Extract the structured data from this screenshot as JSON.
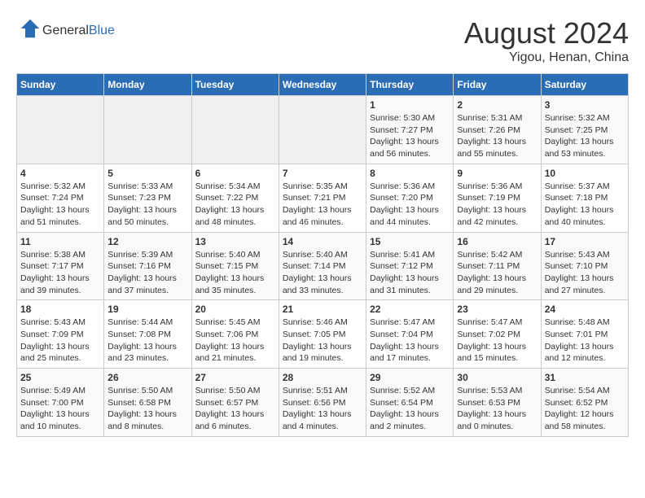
{
  "header": {
    "logo_general": "General",
    "logo_blue": "Blue",
    "main_title": "August 2024",
    "subtitle": "Yigou, Henan, China"
  },
  "calendar": {
    "weekdays": [
      "Sunday",
      "Monday",
      "Tuesday",
      "Wednesday",
      "Thursday",
      "Friday",
      "Saturday"
    ],
    "weeks": [
      [
        {
          "day": "",
          "sunrise": "",
          "sunset": "",
          "daylight": ""
        },
        {
          "day": "",
          "sunrise": "",
          "sunset": "",
          "daylight": ""
        },
        {
          "day": "",
          "sunrise": "",
          "sunset": "",
          "daylight": ""
        },
        {
          "day": "",
          "sunrise": "",
          "sunset": "",
          "daylight": ""
        },
        {
          "day": "1",
          "sunrise": "Sunrise: 5:30 AM",
          "sunset": "Sunset: 7:27 PM",
          "daylight": "Daylight: 13 hours and 56 minutes."
        },
        {
          "day": "2",
          "sunrise": "Sunrise: 5:31 AM",
          "sunset": "Sunset: 7:26 PM",
          "daylight": "Daylight: 13 hours and 55 minutes."
        },
        {
          "day": "3",
          "sunrise": "Sunrise: 5:32 AM",
          "sunset": "Sunset: 7:25 PM",
          "daylight": "Daylight: 13 hours and 53 minutes."
        }
      ],
      [
        {
          "day": "4",
          "sunrise": "Sunrise: 5:32 AM",
          "sunset": "Sunset: 7:24 PM",
          "daylight": "Daylight: 13 hours and 51 minutes."
        },
        {
          "day": "5",
          "sunrise": "Sunrise: 5:33 AM",
          "sunset": "Sunset: 7:23 PM",
          "daylight": "Daylight: 13 hours and 50 minutes."
        },
        {
          "day": "6",
          "sunrise": "Sunrise: 5:34 AM",
          "sunset": "Sunset: 7:22 PM",
          "daylight": "Daylight: 13 hours and 48 minutes."
        },
        {
          "day": "7",
          "sunrise": "Sunrise: 5:35 AM",
          "sunset": "Sunset: 7:21 PM",
          "daylight": "Daylight: 13 hours and 46 minutes."
        },
        {
          "day": "8",
          "sunrise": "Sunrise: 5:36 AM",
          "sunset": "Sunset: 7:20 PM",
          "daylight": "Daylight: 13 hours and 44 minutes."
        },
        {
          "day": "9",
          "sunrise": "Sunrise: 5:36 AM",
          "sunset": "Sunset: 7:19 PM",
          "daylight": "Daylight: 13 hours and 42 minutes."
        },
        {
          "day": "10",
          "sunrise": "Sunrise: 5:37 AM",
          "sunset": "Sunset: 7:18 PM",
          "daylight": "Daylight: 13 hours and 40 minutes."
        }
      ],
      [
        {
          "day": "11",
          "sunrise": "Sunrise: 5:38 AM",
          "sunset": "Sunset: 7:17 PM",
          "daylight": "Daylight: 13 hours and 39 minutes."
        },
        {
          "day": "12",
          "sunrise": "Sunrise: 5:39 AM",
          "sunset": "Sunset: 7:16 PM",
          "daylight": "Daylight: 13 hours and 37 minutes."
        },
        {
          "day": "13",
          "sunrise": "Sunrise: 5:40 AM",
          "sunset": "Sunset: 7:15 PM",
          "daylight": "Daylight: 13 hours and 35 minutes."
        },
        {
          "day": "14",
          "sunrise": "Sunrise: 5:40 AM",
          "sunset": "Sunset: 7:14 PM",
          "daylight": "Daylight: 13 hours and 33 minutes."
        },
        {
          "day": "15",
          "sunrise": "Sunrise: 5:41 AM",
          "sunset": "Sunset: 7:12 PM",
          "daylight": "Daylight: 13 hours and 31 minutes."
        },
        {
          "day": "16",
          "sunrise": "Sunrise: 5:42 AM",
          "sunset": "Sunset: 7:11 PM",
          "daylight": "Daylight: 13 hours and 29 minutes."
        },
        {
          "day": "17",
          "sunrise": "Sunrise: 5:43 AM",
          "sunset": "Sunset: 7:10 PM",
          "daylight": "Daylight: 13 hours and 27 minutes."
        }
      ],
      [
        {
          "day": "18",
          "sunrise": "Sunrise: 5:43 AM",
          "sunset": "Sunset: 7:09 PM",
          "daylight": "Daylight: 13 hours and 25 minutes."
        },
        {
          "day": "19",
          "sunrise": "Sunrise: 5:44 AM",
          "sunset": "Sunset: 7:08 PM",
          "daylight": "Daylight: 13 hours and 23 minutes."
        },
        {
          "day": "20",
          "sunrise": "Sunrise: 5:45 AM",
          "sunset": "Sunset: 7:06 PM",
          "daylight": "Daylight: 13 hours and 21 minutes."
        },
        {
          "day": "21",
          "sunrise": "Sunrise: 5:46 AM",
          "sunset": "Sunset: 7:05 PM",
          "daylight": "Daylight: 13 hours and 19 minutes."
        },
        {
          "day": "22",
          "sunrise": "Sunrise: 5:47 AM",
          "sunset": "Sunset: 7:04 PM",
          "daylight": "Daylight: 13 hours and 17 minutes."
        },
        {
          "day": "23",
          "sunrise": "Sunrise: 5:47 AM",
          "sunset": "Sunset: 7:02 PM",
          "daylight": "Daylight: 13 hours and 15 minutes."
        },
        {
          "day": "24",
          "sunrise": "Sunrise: 5:48 AM",
          "sunset": "Sunset: 7:01 PM",
          "daylight": "Daylight: 13 hours and 12 minutes."
        }
      ],
      [
        {
          "day": "25",
          "sunrise": "Sunrise: 5:49 AM",
          "sunset": "Sunset: 7:00 PM",
          "daylight": "Daylight: 13 hours and 10 minutes."
        },
        {
          "day": "26",
          "sunrise": "Sunrise: 5:50 AM",
          "sunset": "Sunset: 6:58 PM",
          "daylight": "Daylight: 13 hours and 8 minutes."
        },
        {
          "day": "27",
          "sunrise": "Sunrise: 5:50 AM",
          "sunset": "Sunset: 6:57 PM",
          "daylight": "Daylight: 13 hours and 6 minutes."
        },
        {
          "day": "28",
          "sunrise": "Sunrise: 5:51 AM",
          "sunset": "Sunset: 6:56 PM",
          "daylight": "Daylight: 13 hours and 4 minutes."
        },
        {
          "day": "29",
          "sunrise": "Sunrise: 5:52 AM",
          "sunset": "Sunset: 6:54 PM",
          "daylight": "Daylight: 13 hours and 2 minutes."
        },
        {
          "day": "30",
          "sunrise": "Sunrise: 5:53 AM",
          "sunset": "Sunset: 6:53 PM",
          "daylight": "Daylight: 13 hours and 0 minutes."
        },
        {
          "day": "31",
          "sunrise": "Sunrise: 5:54 AM",
          "sunset": "Sunset: 6:52 PM",
          "daylight": "Daylight: 12 hours and 58 minutes."
        }
      ]
    ]
  }
}
